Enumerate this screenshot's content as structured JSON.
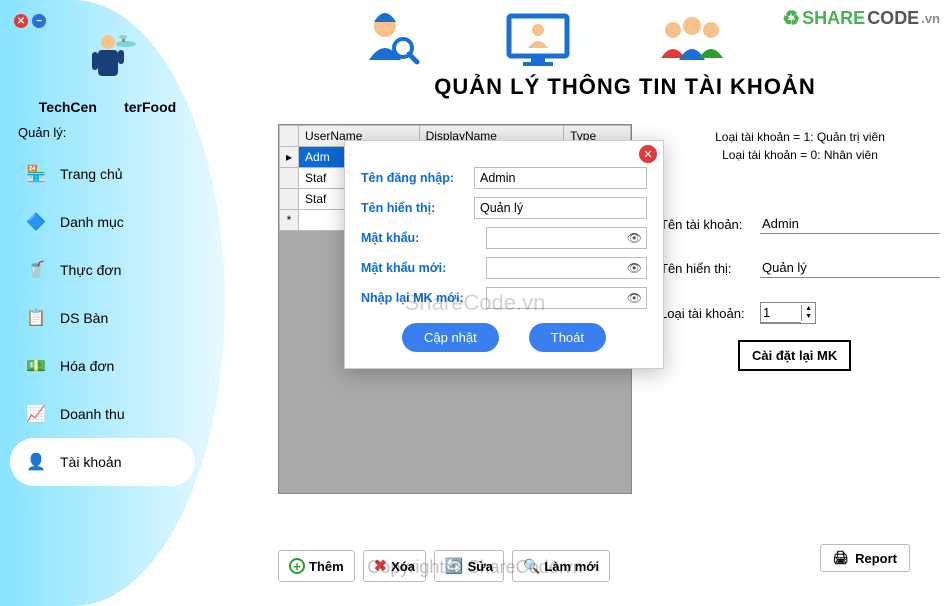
{
  "window": {
    "close_sym": "✕",
    "min_sym": "−"
  },
  "watermark": {
    "logo_share": "SHARE",
    "logo_code": "CODE",
    "logo_vn": ".vn",
    "center": "ShareCode.vn",
    "bottom": "Copyright © ShareCode.vn"
  },
  "brand": {
    "left": "TechCen",
    "right": "terFood"
  },
  "sidebar": {
    "manage_label": "Quản lý:",
    "items": [
      {
        "label": "Trang chủ",
        "icon": "🏪"
      },
      {
        "label": "Danh mục",
        "icon": "🔷"
      },
      {
        "label": "Thực đơn",
        "icon": "🥤"
      },
      {
        "label": "DS Bàn",
        "icon": "📋"
      },
      {
        "label": "Hóa đơn",
        "icon": "💵"
      },
      {
        "label": "Doanh thu",
        "icon": "📈"
      },
      {
        "label": "Tài khoản",
        "icon": "👤"
      }
    ]
  },
  "page": {
    "title": "QUẢN LÝ THÔNG TIN TÀI KHOẢN"
  },
  "grid": {
    "columns": [
      "UserName",
      "DisplayName",
      "Type"
    ],
    "rows": [
      {
        "c0": "Adm"
      },
      {
        "c0": "Staf"
      },
      {
        "c0": "Staf"
      }
    ],
    "new_row_marker": "*",
    "sel_marker": "▸"
  },
  "info": {
    "line1": "Loại tài khoản = 1: Quản trị viên",
    "line2": "Loại tài khoản = 0: Nhân viên"
  },
  "form": {
    "account_label": "Tên tài khoản:",
    "account_value": "Admin",
    "display_label": "Tên hiển thị:",
    "display_value": "Quản lý",
    "type_label": "Loại tài khoản:",
    "type_value": "1",
    "reset_btn": "Cài đặt lại MK"
  },
  "actions": {
    "add": "Thêm",
    "delete": "Xóa",
    "edit": "Sửa",
    "refresh": "Làm mới",
    "report": "Report"
  },
  "modal": {
    "username_label": "Tên đăng nhập:",
    "username_value": "Admin",
    "display_label": "Tên hiển thị:",
    "display_value": "Quản lý",
    "password_label": "Mật khẩu:",
    "newpw_label": "Mật khẩu mới:",
    "confirm_label": "Nhập lại MK mới:",
    "update_btn": "Cập nhật",
    "exit_btn": "Thoát"
  },
  "chart_data": null
}
